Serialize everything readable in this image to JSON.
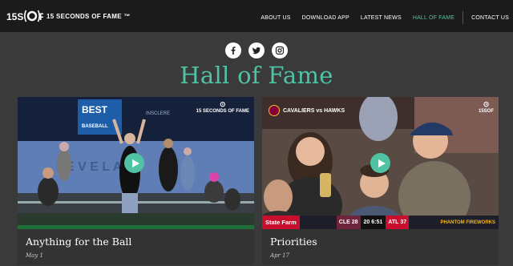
{
  "brand": {
    "logo_text": "15SOF",
    "name": "15 SECONDS OF FAME ™"
  },
  "nav": {
    "items": [
      {
        "label": "ABOUT US",
        "active": false
      },
      {
        "label": "DOWNLOAD APP",
        "active": false
      },
      {
        "label": "LATEST NEWS",
        "active": false
      },
      {
        "label": "HALL OF FAME",
        "active": true
      },
      {
        "label": "CONTACT US",
        "active": false
      }
    ]
  },
  "social": [
    {
      "icon": "facebook-icon"
    },
    {
      "icon": "twitter-icon"
    },
    {
      "icon": "instagram-icon"
    }
  ],
  "page": {
    "title": "Hall of Fame"
  },
  "cards": [
    {
      "title": "Anything for the Ball",
      "date": "May 1",
      "watermark": "15 SECONDS OF FAME",
      "scene_text": {
        "sign1": "BEST",
        "sign2": "BASEBALL",
        "sign3": "INSCLERE",
        "wall": "E V E L A N"
      }
    },
    {
      "title": "Priorities",
      "date": "Apr 17",
      "watermark": "15SOF",
      "scene_text": {
        "matchup": "CAVALIERS vs HAWKS",
        "sponsor": "State Farm",
        "home": "CLE",
        "home_score": "28",
        "clock": "6:51",
        "quarter": "20",
        "away": "ATL",
        "away_score": "37",
        "partner": "PHANTOM FIREWORKS"
      }
    }
  ],
  "colors": {
    "accent": "#4fc3a3",
    "nav_bg": "#1b1b1b",
    "page_bg": "#3a3a3a"
  }
}
